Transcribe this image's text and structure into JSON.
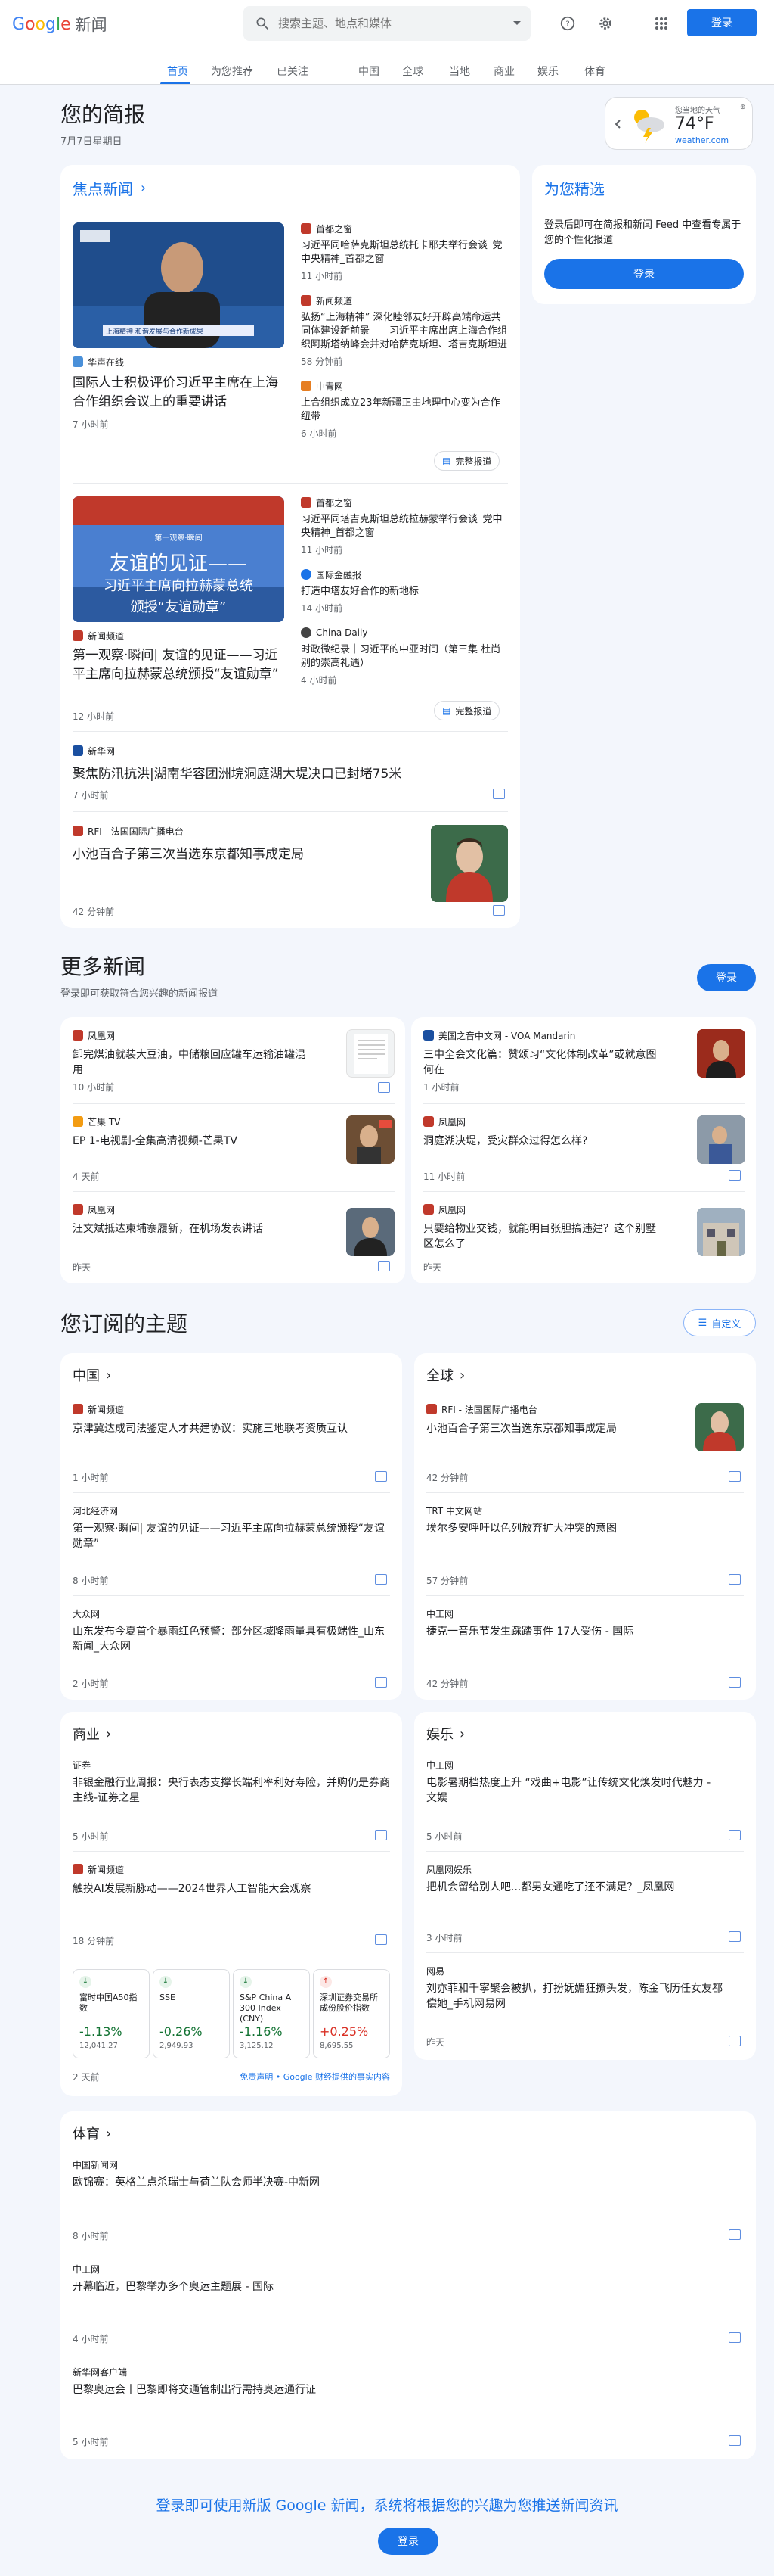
{
  "header": {
    "logo_news": "新闻",
    "search_placeholder": "搜索主题、地点和媒体",
    "login": "登录"
  },
  "tabs": [
    "首页",
    "为您推荐",
    "已关注",
    "中国",
    "全球",
    "当地",
    "商业",
    "娱乐",
    "体育"
  ],
  "briefing": {
    "title": "您的简报",
    "date": "7月7日星期日"
  },
  "weather": {
    "label": "您当地的天气",
    "temp": "74°F",
    "source": "weather.com"
  },
  "top": {
    "title": "焦点新闻",
    "full_coverage": "完整报道",
    "story1": {
      "main_source": "华声在线",
      "main_title": "国际人士积极评价习近平主席在上海合作组织会议上的重要讲话",
      "main_time": "7 小时前",
      "side": [
        {
          "source": "首都之窗",
          "title": "习近平同哈萨克斯坦总统托卡耶夫举行会谈_党中央精神_首都之窗",
          "time": "11 小时前"
        },
        {
          "source": "新闻频道",
          "title": "弘扬“上海精神” 深化睦邻友好开辟高端命运共同体建设新前景——习近平主席出席上海合作组织阿斯塔纳峰会并对哈萨克斯坦、塔吉克斯坦进行国事访问",
          "time": "58 分钟前"
        },
        {
          "source": "中青网",
          "title": "上合组织成立23年新疆正由地理中心变为合作纽带",
          "time": "6 小时前"
        }
      ],
      "thumb_caption": "上海精神 和谐发展与合作新成果"
    },
    "story2": {
      "main_source": "新闻频道",
      "main_title": "第一观察·瞬间| 友谊的见证——习近平主席向拉赫蒙总统颁授“友谊勋章”",
      "main_time": "12 小时前",
      "thumb_text1": "友谊的见证——",
      "thumb_text2": "习近平主席向拉赫蒙总统",
      "thumb_text3": "颁授“友谊勋章”",
      "thumb_top": "第一观察·瞬间",
      "side": [
        {
          "source": "首都之窗",
          "title": "习近平同塔吉克斯坦总统拉赫蒙举行会谈_党中央精神_首都之窗",
          "time": "11 小时前"
        },
        {
          "source": "国际金融报",
          "title": "打造中塔友好合作的新地标",
          "time": "14 小时前"
        },
        {
          "source": "China Daily",
          "title": "时政微纪录｜习近平的中亚时间（第三集 杜尚别的崇高礼遇）",
          "time": "4 小时前"
        }
      ]
    },
    "story3": {
      "source": "新华网",
      "title": "聚焦防汛抗洪|湖南华容团洲垸洞庭湖大堤决口已封堵75米",
      "time": "7 小时前"
    },
    "story4": {
      "source": "RFI - 法国国际广播电台",
      "title": "小池百合子第三次当选东京都知事成定局",
      "time": "42 分钟前"
    }
  },
  "picks": {
    "title": "为您精选",
    "text": "登录后即可在简报和新闻 Feed 中查看专属于您的个性化报道",
    "button": "登录"
  },
  "more": {
    "title": "更多新闻",
    "subtitle": "登录即可获取符合您兴趣的新闻报道",
    "button": "登录",
    "items": [
      {
        "source": "凤凰网",
        "title": "卸完煤油就装大豆油，中储粮回应罐车运输油罐混用",
        "time": "10 小时前"
      },
      {
        "source": "美国之音中文网 - VOA Mandarin",
        "title": "三中全会文化篇：赞颂习“文化体制改革”或就意图何在",
        "time": "1 小时前"
      },
      {
        "source": "芒果 TV",
        "title": "EP 1-电视剧-全集高清视频-芒果TV",
        "time": "4 天前"
      },
      {
        "source": "凤凰网",
        "title": "洞庭湖决堤，受灾群众过得怎么样?",
        "time": "11 小时前"
      },
      {
        "source": "凤凰网",
        "title": "汪文斌抵达柬埔寨履新，在机场发表讲话",
        "time": "昨天"
      },
      {
        "source": "凤凰网",
        "title": "只要给物业交钱，就能明目张胆搞违建？这个别墅区怎么了",
        "time": "昨天"
      }
    ]
  },
  "topics": {
    "title": "您订阅的主题",
    "customize": "自定义",
    "china": {
      "title": "中国",
      "items": [
        {
          "source": "新闻频道",
          "title": "京津冀达成司法鉴定人才共建协议：实施三地联考资质互认",
          "time": "1 小时前"
        },
        {
          "source": "河北经济网",
          "title": "第一观察·瞬间| 友谊的见证——习近平主席向拉赫蒙总统颁授“友谊勋章”",
          "time": "8 小时前"
        },
        {
          "source": "大众网",
          "title": "山东发布今夏首个暴雨红色预警：部分区域降雨量具有极端性_山东新闻_大众网",
          "time": "2 小时前"
        }
      ]
    },
    "world": {
      "title": "全球",
      "items": [
        {
          "source": "RFI - 法国国际广播电台",
          "title": "小池百合子第三次当选东京都知事成定局",
          "time": "42 分钟前"
        },
        {
          "source": "TRT 中文网站",
          "title": "埃尔多安呼吁以色列放弃扩大冲突的意图",
          "time": "57 分钟前"
        },
        {
          "source": "中工网",
          "title": "捷克一音乐节发生踩踏事件 17人受伤 - 国际",
          "time": "42 分钟前"
        }
      ]
    },
    "business": {
      "title": "商业",
      "items": [
        {
          "source": "证券",
          "title": "非银金融行业周报：央行表态支撑长端利率利好寿险，并购仍是券商主线-证券之星",
          "time": "5 小时前"
        },
        {
          "source": "新闻频道",
          "title": "触摸AI发展新脉动——2024世界人工智能大会观察",
          "time": "18 分钟前"
        }
      ],
      "stocks": [
        {
          "name": "富时中国A50指数",
          "change": "-1.13%",
          "value": "12,041.27",
          "dir": "down"
        },
        {
          "name": "SSE",
          "change": "-0.26%",
          "value": "2,949.93",
          "dir": "down"
        },
        {
          "name": "S&P China A 300 Index (CNY)",
          "change": "-1.16%",
          "value": "3,125.12",
          "dir": "down"
        },
        {
          "name": "深圳证券交易所成份股价指数",
          "change": "+0.25%",
          "value": "8,695.55",
          "dir": "up"
        }
      ],
      "time": "2 天前",
      "disclaimer": "免责声明 • Google 财经提供的事实内容"
    },
    "ent": {
      "title": "娱乐",
      "items": [
        {
          "source": "中工网",
          "title": "电影暑期档热度上升 “戏曲+电影”让传统文化焕发时代魅力 - 文娱",
          "time": "5 小时前"
        },
        {
          "source": "凤凰网娱乐",
          "title": "把机会留给别人吧...都男女通吃了还不满足？_凤凰网",
          "time": "3 小时前"
        },
        {
          "source": "网易",
          "title": "刘亦菲和千寧聚会被扒，打扮妩媚狂撩头发，陈金飞历任女友都偿她_手机网易网",
          "time": "昨天"
        }
      ]
    },
    "sports": {
      "title": "体育",
      "items": [
        {
          "source": "中国新闻网",
          "title": "欧锦赛：英格兰点杀瑞士与荷兰队会师半决赛-中新网",
          "time": "8 小时前"
        },
        {
          "source": "中工网",
          "title": "开幕临近，巴黎举办多个奥运主题展 - 国际",
          "time": "4 小时前"
        },
        {
          "source": "新华网客户端",
          "title": "巴黎奥运会丨巴黎即将交通管制出行需持奥运通行证",
          "time": "5 小时前"
        }
      ]
    }
  },
  "footer": {
    "text": "登录即可使用新版 Google 新闻，系统将根据您的兴趣为您推送新闻资讯",
    "button": "登录"
  },
  "colors": {
    "accent": "#1a73e8",
    "down": "#d93025",
    "up": "#137333"
  }
}
